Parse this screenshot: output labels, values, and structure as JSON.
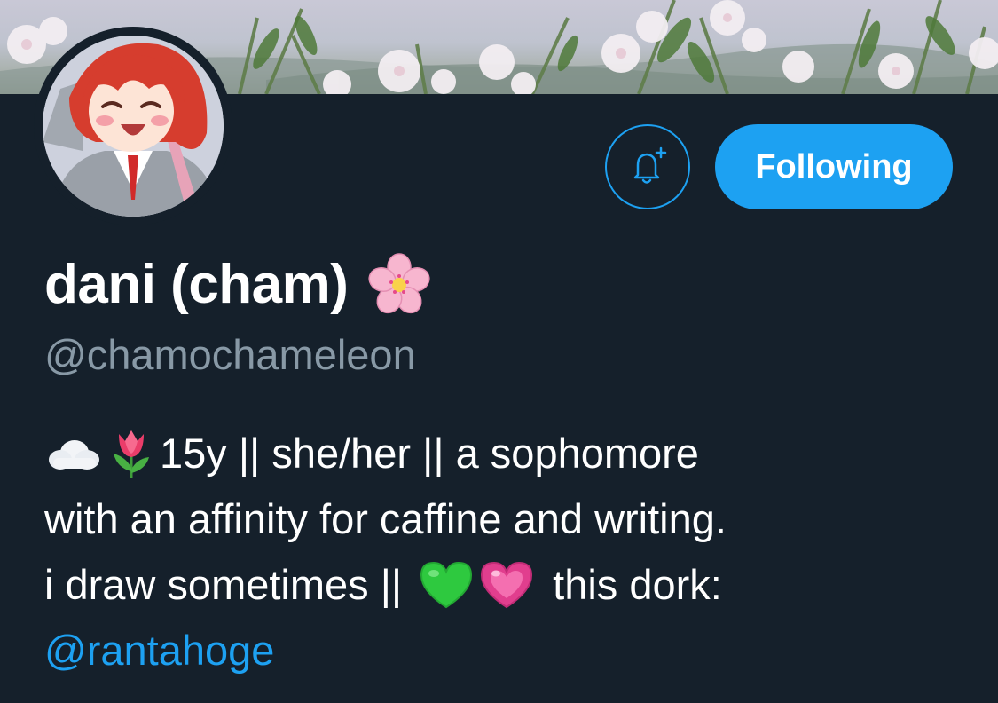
{
  "profile": {
    "display_name": "dani (cham)",
    "display_name_emoji": "cherry-blossom",
    "handle": "@chamochameleon"
  },
  "actions": {
    "notify_icon": "bell-plus-icon",
    "follow_label": "Following"
  },
  "bio": {
    "line1_emojis": [
      "cloud",
      "tulip"
    ],
    "line1_text": "15y || she/her || a sophomore",
    "line2_text": "with an affinity for caffine and writing.",
    "line3_text_a": "i draw sometimes ||",
    "line3_emojis": [
      "green-heart",
      "sparkling-heart"
    ],
    "line3_text_b": "this dork:",
    "mention": "@rantahoge"
  },
  "colors": {
    "background": "#15202b",
    "accent": "#1da1f2",
    "secondary_text": "#8899a6",
    "primary_text": "#ffffff"
  }
}
